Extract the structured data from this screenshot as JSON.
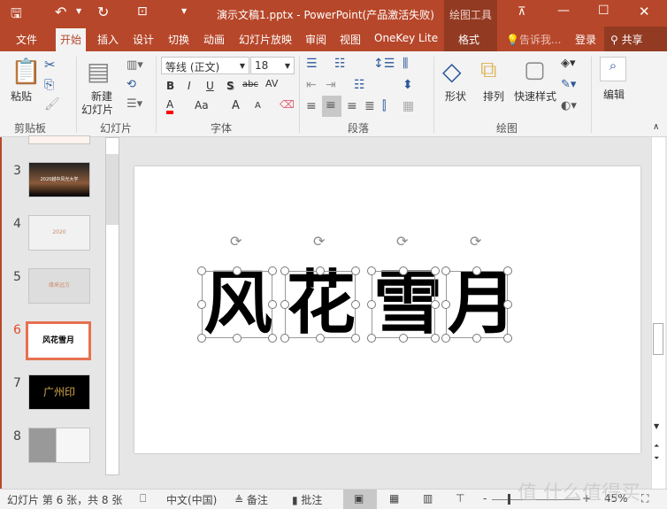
{
  "titlebar": {
    "title": "演示文稿1.pptx - PowerPoint(产品激活失败)",
    "context_tab": "绘图工具",
    "icons": [
      "save-icon",
      "undo-icon",
      "redo-icon",
      "slideshow-icon",
      "customize-icon",
      "ribbon-display-icon",
      "minimize-icon",
      "maximize-icon",
      "close-icon"
    ]
  },
  "tabs": [
    "文件",
    "开始",
    "插入",
    "设计",
    "切换",
    "动画",
    "幻灯片放映",
    "审阅",
    "视图",
    "OneKey Lite",
    "格式"
  ],
  "tell_me": "告诉我...",
  "login": "登录",
  "share": "共享",
  "ribbon": {
    "clipboard": {
      "paste": "粘贴",
      "label": "剪贴板"
    },
    "slides": {
      "new_slide_1": "新建",
      "new_slide_2": "幻灯片",
      "label": "幻灯片"
    },
    "font": {
      "font_name": "等线 (正文)",
      "font_size": "18",
      "bold": "B",
      "italic": "I",
      "underline": "U",
      "shadow": "S",
      "strike": "abc",
      "spacing": "AV",
      "color": "A",
      "case": "Aa",
      "grow": "A",
      "shrink": "A",
      "label": "字体",
      "font_color": "#ff0000"
    },
    "paragraph": {
      "label": "段落"
    },
    "drawing": {
      "shapes": "形状",
      "arrange": "排列",
      "quick_styles": "快速样式",
      "label": "绘图"
    },
    "editing": {
      "label": "编辑"
    }
  },
  "thumbnails": [
    {
      "num": "3",
      "text": "2020越中风光大学"
    },
    {
      "num": "4",
      "text": "2020"
    },
    {
      "num": "5",
      "text": "缘来远方"
    },
    {
      "num": "6",
      "text": "风花雪月",
      "active": true
    },
    {
      "num": "7",
      "text": "广州印"
    },
    {
      "num": "8",
      "text": ""
    }
  ],
  "slide": {
    "chars": [
      "风",
      "花",
      "雪",
      "月"
    ]
  },
  "status": {
    "slide_info": "幻灯片 第 6 张，共 8 张",
    "language": "中文(中国)",
    "notes": "备注",
    "comments": "批注",
    "zoom": "45%",
    "zoom_percent": 45
  },
  "watermark": "值 什么值得买",
  "colors": {
    "accent": "#b7472a",
    "active_thumb": "#e8704f"
  }
}
